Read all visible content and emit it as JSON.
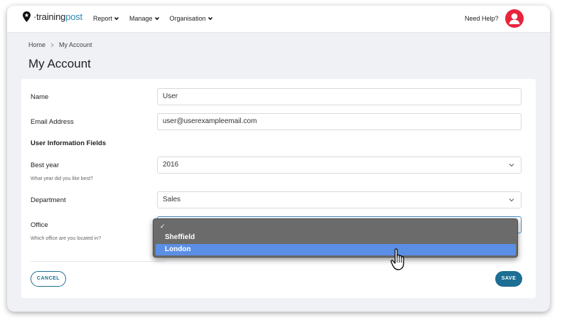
{
  "app": {
    "logo_prefix": "·",
    "logo_training": "training",
    "logo_post": "post"
  },
  "nav": {
    "items": [
      {
        "label": "Report"
      },
      {
        "label": "Manage"
      },
      {
        "label": "Organisation"
      }
    ],
    "help_label": "Need Help?"
  },
  "breadcrumb": {
    "home": "Home",
    "current": "My Account"
  },
  "page": {
    "title": "My Account"
  },
  "form": {
    "name_label": "Name",
    "name_value": "User",
    "email_label": "Email Address",
    "email_value": "user@userexampleemail.com",
    "section_title": "User Information Fields",
    "best_year_label": "Best year",
    "best_year_hint": "What year did you like best?",
    "best_year_value": "2016",
    "department_label": "Department",
    "department_value": "Sales",
    "office_label": "Office",
    "office_hint": "Which office are you located in?",
    "office_value": "",
    "cancel_label": "CANCEL",
    "save_label": "SAVE"
  },
  "office_dropdown": {
    "check_glyph": "✓",
    "options": [
      "Sheffield",
      "London"
    ],
    "highlighted": "London"
  },
  "colors": {
    "brand_blue": "#1d6e94",
    "logo_accent": "#2f8ab3",
    "avatar_red": "#e8243c",
    "highlight": "#5b8fe6"
  }
}
